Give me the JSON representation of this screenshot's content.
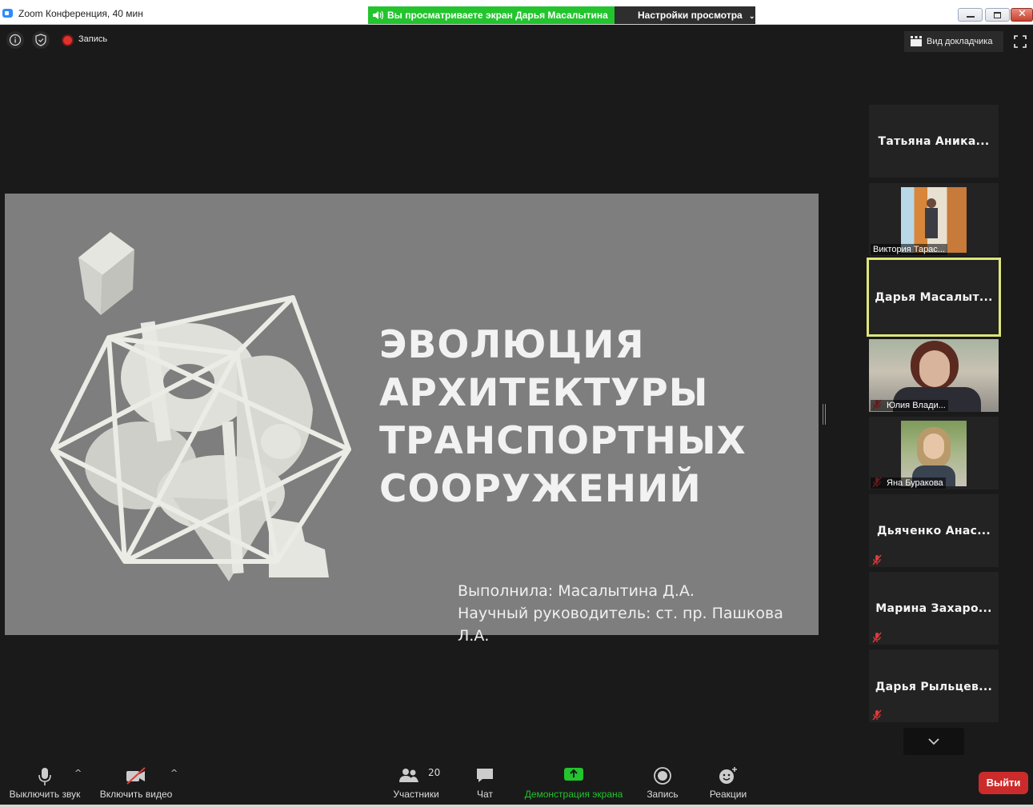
{
  "window": {
    "title": "Zoom Конференция, 40 мин",
    "share_banner": "Вы просматриваете экран Дарья Масалытина",
    "view_settings": "Настройки просмотра"
  },
  "topbar": {
    "record_label": "Запись",
    "speaker_view": "Вид докладчика"
  },
  "slide": {
    "title_lines": [
      "ЭВОЛЮЦИЯ",
      "АРХИТЕКТУРЫ",
      "ТРАНСПОРТНЫХ",
      "СООРУЖЕНИЙ"
    ],
    "author": "Выполнила: Масалытина Д.А.",
    "supervisor": "Научный руководитель: ст. пр. Пашкова Л.А."
  },
  "participants": [
    {
      "name": "Татьяна  Аника...",
      "video": false,
      "muted": false,
      "active": false
    },
    {
      "name": "Виктория Тарас...",
      "video": true,
      "muted": false,
      "active": false
    },
    {
      "name": "Дарья  Масалыт...",
      "video": false,
      "muted": false,
      "active": true
    },
    {
      "name": "Юлия Влади...",
      "video": true,
      "muted": true,
      "active": false
    },
    {
      "name": "Яна Буракова",
      "video": true,
      "muted": true,
      "active": false
    },
    {
      "name": "Дьяченко  Анас...",
      "video": false,
      "muted": true,
      "active": false
    },
    {
      "name": "Марина  Захаро...",
      "video": false,
      "muted": true,
      "active": false
    },
    {
      "name": "Дарья  Рыльцев...",
      "video": false,
      "muted": true,
      "active": false
    }
  ],
  "toolbar": {
    "mute": "Выключить звук",
    "video": "Включить видео",
    "participants": "Участники",
    "participants_count": "20",
    "chat": "Чат",
    "share": "Демонстрация экрана",
    "record": "Запись",
    "reactions": "Реакции",
    "leave": "Выйти"
  },
  "colors": {
    "share_green": "#23c42e",
    "leave_red": "#cc2b2b",
    "active_speaker": "#dfe67a"
  }
}
